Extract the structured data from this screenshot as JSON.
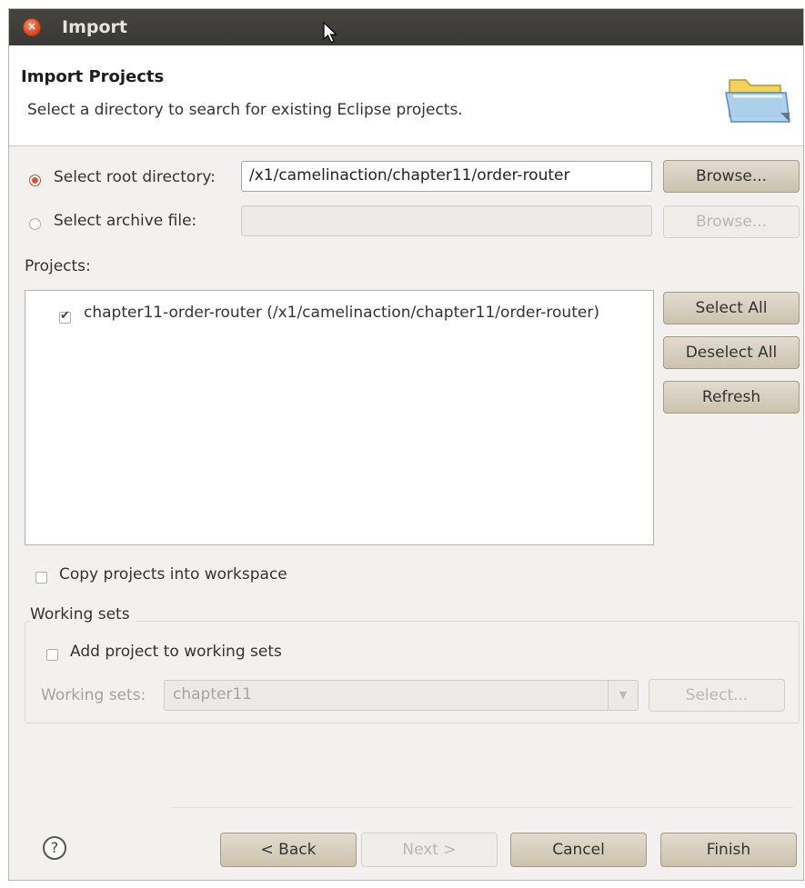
{
  "window": {
    "title": "Import"
  },
  "header": {
    "title": "Import Projects",
    "description": "Select a directory to search for existing Eclipse projects."
  },
  "source": {
    "root_label": "Select root directory:",
    "root_value": "/x1/camelinaction/chapter11/order-router",
    "root_selected": true,
    "archive_label": "Select archive file:",
    "archive_value": "",
    "browse_label": "Browse...",
    "browse_disabled_label": "Browse..."
  },
  "projects": {
    "label": "Projects:",
    "items": [
      {
        "label": "chapter11-order-router (/x1/camelinaction/chapter11/order-router)",
        "checked": true
      }
    ],
    "buttons": {
      "select_all": "Select All",
      "deselect_all": "Deselect All",
      "refresh": "Refresh"
    }
  },
  "options": {
    "copy_label": "Copy projects into workspace",
    "copy_checked": false
  },
  "working_sets": {
    "group_label": "Working sets",
    "add_label": "Add project to working sets",
    "add_checked": false,
    "field_label": "Working sets:",
    "field_value": "chapter11",
    "select_label": "Select..."
  },
  "footer": {
    "help_glyph": "?",
    "back_label": "< Back",
    "next_label": "Next >",
    "cancel_label": "Cancel",
    "finish_label": "Finish"
  },
  "colors": {
    "accent": "#e2502c",
    "button": "#d6cfbe",
    "titlebar": "#3f3e3a"
  }
}
